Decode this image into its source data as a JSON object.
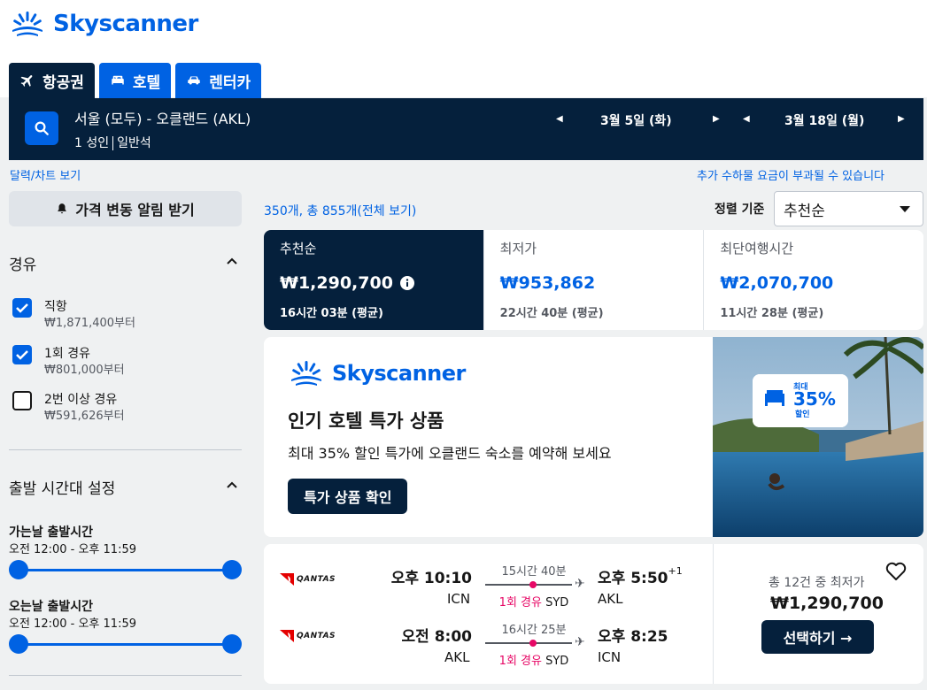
{
  "brand": {
    "name": "Skyscanner"
  },
  "tabs": [
    {
      "label": "항공권",
      "icon": "plane-icon"
    },
    {
      "label": "호텔",
      "icon": "bed-icon"
    },
    {
      "label": "렌터카",
      "icon": "car-icon"
    }
  ],
  "search": {
    "route": "서울 (모두) - 오클랜드 (AKL)",
    "passengers": "1 성인",
    "cabin": "일반석",
    "depart_date": "3월 5일 (화)",
    "return_date": "3월 18일 (월)"
  },
  "links": {
    "calendar": "달력/차트 보기",
    "fees": "추가 수하물 요금이 부과될 수 있습니다"
  },
  "sidebar": {
    "alert_button": "가격 변동 알림 받기",
    "stops_title": "경유",
    "stops": [
      {
        "label": "직항",
        "price": "₩1,871,400부터",
        "checked": true
      },
      {
        "label": "1회 경유",
        "price": "₩801,000부터",
        "checked": true
      },
      {
        "label": "2번 이상 경유",
        "price": "₩591,626부터",
        "checked": false
      }
    ],
    "times_title": "출발 시간대 설정",
    "outbound_title": "가는날 출발시간",
    "outbound_range": "오전 12:00 - 오후 11:59",
    "return_title": "오는날 출발시간",
    "return_range": "오전 12:00 - 오후 11:59"
  },
  "results": {
    "count_text": "350개, 총 855개(전체 보기)",
    "sort_label": "정렬 기준",
    "sort_value": "추천순",
    "sort_tabs": [
      {
        "name": "추천순",
        "price": "₩1,290,700",
        "duration": "16시간 03분 (평균)"
      },
      {
        "name": "최저가",
        "price": "₩953,862",
        "duration": "22시간 40분 (평균)"
      },
      {
        "name": "최단여행시간",
        "price": "₩2,070,700",
        "duration": "11시간 28분 (평균)"
      }
    ]
  },
  "promo": {
    "brand": "Skyscanner",
    "title": "인기 호텔 특가 상품",
    "subtitle": "최대 35% 할인 특가에 오클랜드 숙소를 예약해 보세요",
    "button": "특가 상품 확인",
    "badge_top": "최대",
    "badge_pct": "35%",
    "badge_bottom": "할인"
  },
  "flight": {
    "outbound": {
      "airline": "QANTAS",
      "dep_time": "오후 10:10",
      "dep_airport": "ICN",
      "duration": "15시간 40분",
      "stops": "1회 경유",
      "via": "SYD",
      "arr_time": "오후 5:50",
      "day_offset": "+1",
      "arr_airport": "AKL"
    },
    "inbound": {
      "airline": "QANTAS",
      "dep_time": "오전 8:00",
      "dep_airport": "AKL",
      "duration": "16시간 25분",
      "stops": "1회 경유",
      "via": "SYD",
      "arr_time": "오후 8:25",
      "arr_airport": "ICN"
    },
    "deal_text": "총 12건 중 최저가",
    "price": "₩1,290,700",
    "select_button": "선택하기 →"
  },
  "colors": {
    "primary": "#0062e3",
    "dark": "#05203c",
    "stop": "#e70866"
  }
}
